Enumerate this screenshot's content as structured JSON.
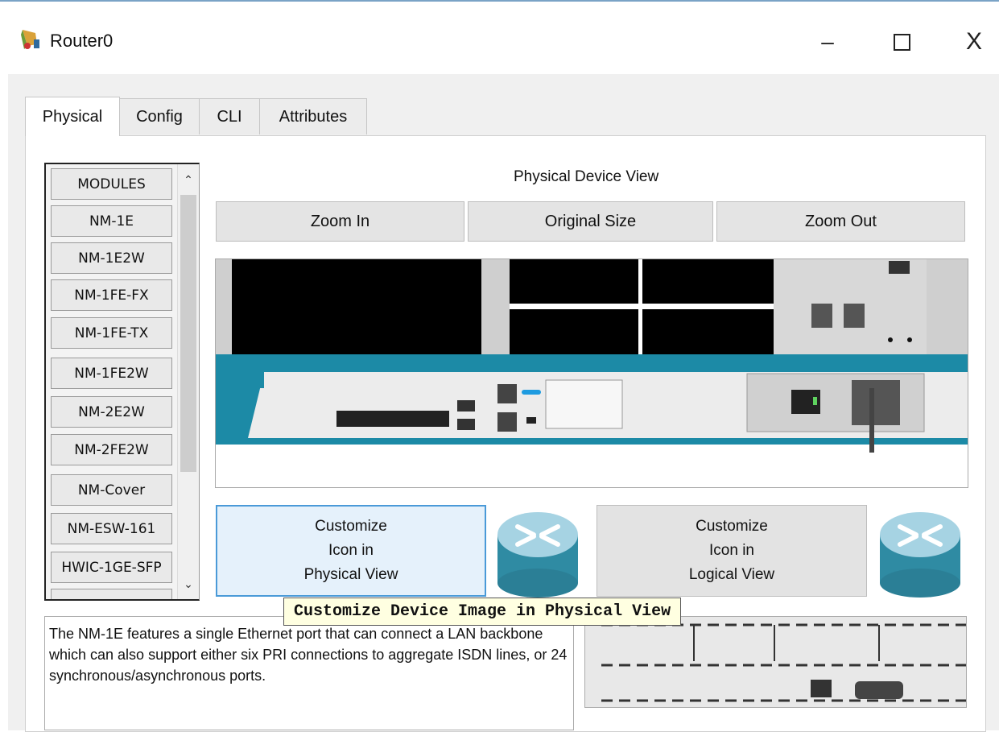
{
  "window": {
    "title": "Router0",
    "app_icon": "router-app-icon",
    "controls": {
      "minimize": "–",
      "maximize": "",
      "close": "X"
    }
  },
  "tabs": [
    {
      "label": "Physical",
      "active": true
    },
    {
      "label": "Config",
      "active": false
    },
    {
      "label": "CLI",
      "active": false
    },
    {
      "label": "Attributes",
      "active": false
    }
  ],
  "modules": {
    "header": "MODULES",
    "items": [
      "NM-1E",
      "NM-1E2W",
      "NM-1FE-FX",
      "NM-1FE-TX",
      "NM-1FE2W",
      "NM-2E2W",
      "NM-2FE2W",
      "NM-Cover",
      "NM-ESW-161",
      "HWIC-1GE-SFP"
    ],
    "scroll_up_icon": "chevron-up-icon",
    "scroll_down_icon": "chevron-down-icon"
  },
  "physical_view": {
    "title": "Physical Device View",
    "zoom_in": "Zoom In",
    "original_size": "Original Size",
    "zoom_out": "Zoom Out"
  },
  "customize": {
    "physical": [
      "Customize",
      "Icon in",
      "Physical View"
    ],
    "logical": [
      "Customize",
      "Icon in",
      "Logical View"
    ]
  },
  "tooltip": "Customize Device Image in Physical View",
  "description": "The NM-1E features a single Ethernet port that can connect a LAN backbone which can also support either six PRI connections to aggregate ISDN lines, or 24 synchronous/asynchronous ports.",
  "colors": {
    "accent_blue": "#4a9ad8",
    "chassis_teal": "#1c8aa6",
    "tooltip_bg": "#ffffe1"
  }
}
